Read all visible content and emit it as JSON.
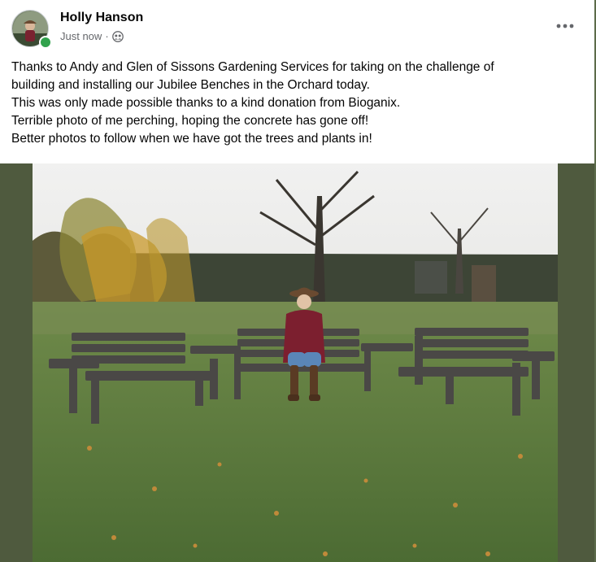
{
  "post": {
    "author": "Holly Hanson",
    "timestamp": "Just now",
    "separator": "·",
    "privacy_icon": "friends-icon",
    "more_icon": "more-horizontal-icon",
    "lines": [
      "Thanks to Andy and Glen of Sissons Gardening Services for taking on the challenge of",
      "building and installing our Jubilee Benches in the Orchard today.",
      "This was only made possible thanks to a kind donation from Bioganix.",
      "Terrible photo of me perching, hoping the concrete has gone off!",
      "Better photos to follow when we have got the trees and plants in!"
    ],
    "photo_icon": "photo-benches-orchard"
  },
  "colors": {
    "text": "#050505",
    "muted": "#65676b",
    "online": "#31a24c",
    "frame": "#4f5a3e"
  }
}
